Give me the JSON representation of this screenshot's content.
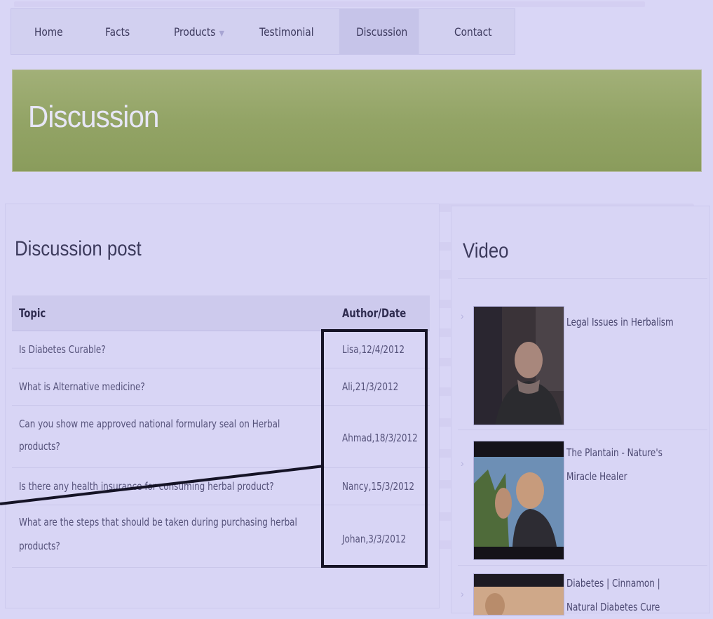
{
  "nav": {
    "items": [
      "Home",
      "Facts",
      "Products",
      "Testimonial",
      "Discussion",
      "Contact"
    ],
    "active": "Discussion"
  },
  "banner": {
    "title": "Discussion"
  },
  "discussion": {
    "heading": "Discussion post",
    "columns": [
      "Topic",
      "Author/Date"
    ],
    "rows": [
      {
        "topic_lines": [
          "Is Diabetes Curable?"
        ],
        "author_date": "Lisa,12/4/2012"
      },
      {
        "topic_lines": [
          "What is Alternative medicine?"
        ],
        "author_date": "Ali,21/3/2012"
      },
      {
        "topic_lines": [
          "Can you show me approved national formulary seal on Herbal",
          "products?"
        ],
        "author_date": "Ahmad,18/3/2012"
      },
      {
        "topic_lines": [
          "Is there any health insurance for consuming herbal product?"
        ],
        "author_date": "Nancy,15/3/2012"
      },
      {
        "topic_lines": [
          "What are the steps that should be taken during purchasing herbal",
          "products?"
        ],
        "author_date": "Johan,3/3/2012"
      }
    ]
  },
  "video": {
    "heading": "Video",
    "items": [
      {
        "title_lines": [
          "Legal Issues in Herbalism"
        ]
      },
      {
        "title_lines": [
          "The Plantain - Nature's",
          "Miracle Healer"
        ]
      },
      {
        "title_lines": [
          "Diabetes | Cinnamon |",
          "Natural Diabetes Cure"
        ]
      }
    ]
  },
  "colors": {
    "background": "#d9d6f6",
    "banner": "#93a466",
    "annotation": "#151326"
  },
  "icons": {
    "nav_dropdown": "caret-down-icon",
    "video_bullet": "chevron-right-icon"
  }
}
